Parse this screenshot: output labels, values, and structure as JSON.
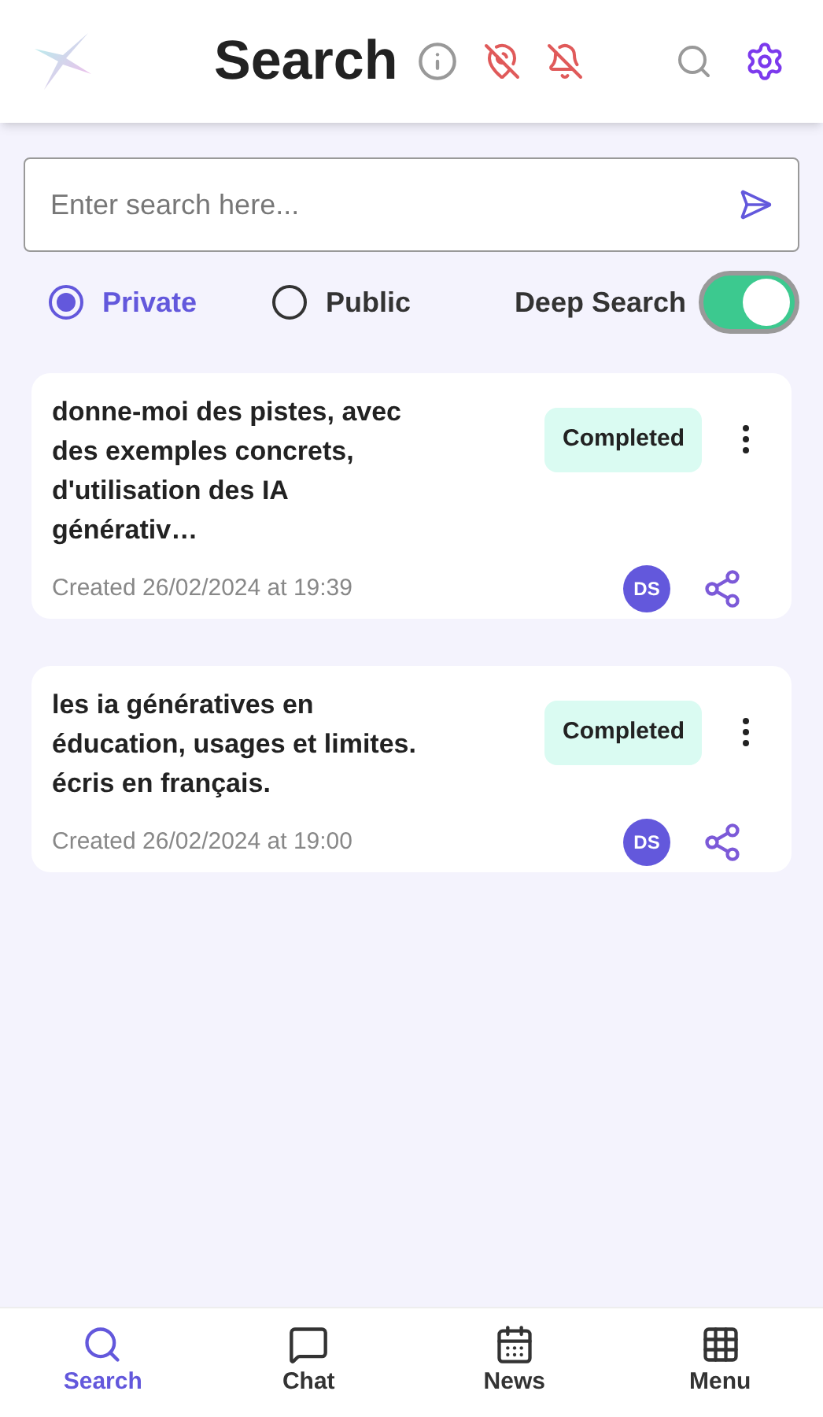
{
  "header": {
    "title": "Search"
  },
  "search": {
    "placeholder": "Enter search here..."
  },
  "visibility": [
    {
      "label": "Private",
      "selected": true
    },
    {
      "label": "Public",
      "selected": false
    }
  ],
  "deep_search": {
    "label": "Deep Search",
    "on": true
  },
  "results": [
    {
      "title": "donne-moi des pistes, avec des exemples concrets, d'utilisation des IA générativ…",
      "status": "Completed",
      "created": "Created 26/02/2024 at 19:39",
      "avatar": "DS"
    },
    {
      "title": "les ia génératives en éducation, usages et limites. écris en français.",
      "status": "Completed",
      "created": "Created 26/02/2024 at 19:00",
      "avatar": "DS"
    }
  ],
  "nav": [
    {
      "label": "Search",
      "kind": "search",
      "selected": true
    },
    {
      "label": "Chat",
      "kind": "chat",
      "selected": false
    },
    {
      "label": "News",
      "kind": "news",
      "selected": false
    },
    {
      "label": "Menu",
      "kind": "menu",
      "selected": false
    }
  ]
}
